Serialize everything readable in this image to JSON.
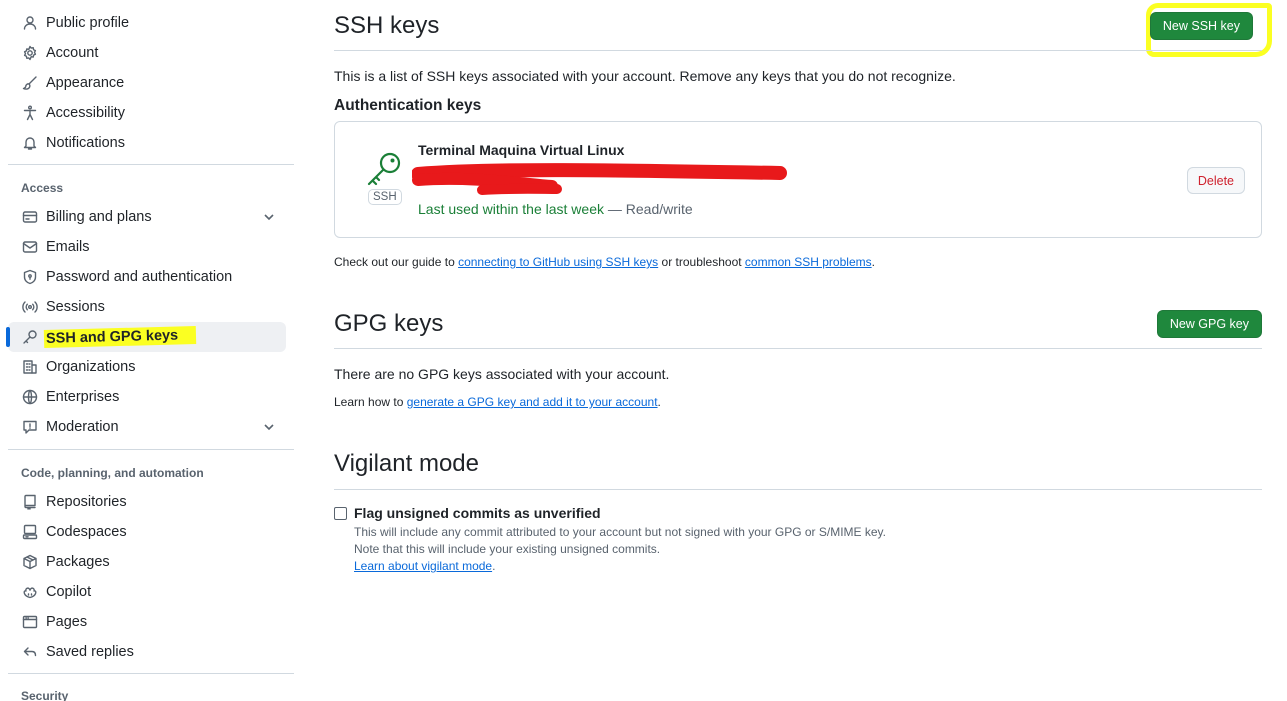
{
  "sidebar": {
    "top_items": [
      {
        "label": "Public profile",
        "icon": "person-icon"
      },
      {
        "label": "Account",
        "icon": "gear-icon"
      },
      {
        "label": "Appearance",
        "icon": "paintbrush-icon"
      },
      {
        "label": "Accessibility",
        "icon": "accessibility-icon"
      },
      {
        "label": "Notifications",
        "icon": "bell-icon"
      }
    ],
    "access_title": "Access",
    "access_items": [
      {
        "label": "Billing and plans",
        "icon": "credit-card-icon"
      },
      {
        "label": "Emails",
        "icon": "mail-icon"
      },
      {
        "label": "Password and authentication",
        "icon": "shield-lock-icon"
      },
      {
        "label": "Sessions",
        "icon": "broadcast-icon"
      },
      {
        "label": "SSH and GPG keys",
        "icon": "key-icon"
      },
      {
        "label": "Organizations",
        "icon": "organization-icon"
      },
      {
        "label": "Enterprises",
        "icon": "globe-icon"
      },
      {
        "label": "Moderation",
        "icon": "report-icon"
      }
    ],
    "code_title": "Code, planning, and automation",
    "code_items": [
      {
        "label": "Repositories",
        "icon": "repo-icon"
      },
      {
        "label": "Codespaces",
        "icon": "codespaces-icon"
      },
      {
        "label": "Packages",
        "icon": "package-icon"
      },
      {
        "label": "Copilot",
        "icon": "copilot-icon"
      },
      {
        "label": "Pages",
        "icon": "browser-icon"
      },
      {
        "label": "Saved replies",
        "icon": "reply-icon"
      }
    ],
    "security_title": "Security"
  },
  "ssh": {
    "title": "SSH keys",
    "new_button": "New SSH key",
    "description": "This is a list of SSH keys associated with your account. Remove any keys that you do not recognize.",
    "auth_heading": "Authentication keys",
    "key": {
      "title": "Terminal Maquina Virtual Linux",
      "badge": "SSH",
      "last_used": "Last used within the last week",
      "access": " — Read/write",
      "delete_button": "Delete"
    },
    "guide_prefix": "Check out our guide to ",
    "guide_link": "connecting to GitHub using SSH keys",
    "guide_middle": " or troubleshoot ",
    "guide_link2": "common SSH problems",
    "guide_suffix": "."
  },
  "gpg": {
    "title": "GPG keys",
    "new_button": "New GPG key",
    "empty": "There are no GPG keys associated with your account.",
    "learn_prefix": "Learn how to ",
    "learn_link": "generate a GPG key and add it to your account",
    "learn_suffix": "."
  },
  "vigilant": {
    "title": "Vigilant mode",
    "checkbox_label": "Flag unsigned commits as unverified",
    "checked": false,
    "desc1": "This will include any commit attributed to your account but not signed with your GPG or S/MIME key.",
    "desc2": "Note that this will include your existing unsigned commits.",
    "learn_link": "Learn about vigilant mode",
    "learn_suffix": "."
  },
  "colors": {
    "primary_button": "#1f883d",
    "link": "#0969da",
    "danger": "#cf222e",
    "highlight": "#fbff22",
    "redaction": "#e8191b",
    "active_indicator": "#0969da"
  }
}
